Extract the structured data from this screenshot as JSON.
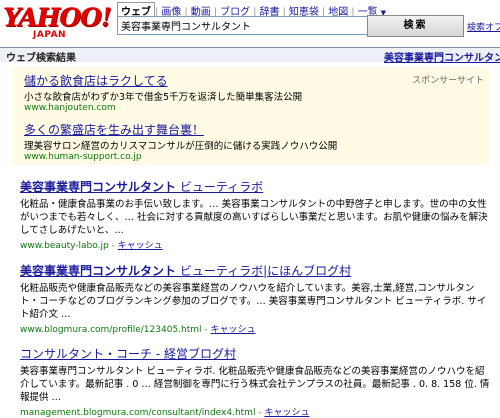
{
  "logo": {
    "main": "YAHOO!",
    "sub": "JAPAN"
  },
  "tabs": [
    "ウェブ",
    "画像",
    "動画",
    "ブログ",
    "辞書",
    "知恵袋",
    "地図",
    "一覧"
  ],
  "tabs_more_arrow": "▼",
  "search": {
    "value": "美容事業専門コンサルタント",
    "button_label": "検索",
    "option_label": "検索オプ"
  },
  "bar": {
    "left": "ウェブ検索結果",
    "right": "美容事業専門コンサルタン"
  },
  "ads": {
    "sponsor_label": "スポンサーサイト",
    "items": [
      {
        "title": "儲かる飲食店はラクしてる",
        "desc": "小さな飲食店がわずか3年で借金5千万を返済した簡単集客法公開",
        "url": "www.hanjouten.com"
      },
      {
        "title": "多くの繁盛店を生み出す舞台裏！",
        "desc": "理美容サロン経営のカリスマコンサルが圧倒的に儲ける実践ノウハウ公開",
        "url": "www.human-support.co.jp"
      }
    ]
  },
  "results": [
    {
      "title_bold": "美容事業専門コンサルタント",
      "title_rest": " ビューティラボ",
      "desc": "化粧品・健康食品事業のお手伝い致します。… 美容事業コンサルタントの中野啓子と申します。世の中の女性がいつまでも若々しく、… 社会に対する貢献度の高いすばらしい事業だと思います。お肌や健康の悩みを解決してさしあげたいと、…",
      "url": "www.beauty-labo.jp",
      "cache": "キャッシュ"
    },
    {
      "title_bold": "美容事業専門コンサルタント",
      "title_rest": " ビューティラボ|にほんブログ村",
      "desc": "化粧品販売や健康食品販売などの美容事業経営のノウハウを紹介しています。美容,士業,経営,コンサルタント・コーチなどのブログランキング参加のブログです。… 美容事業専門コンサルタント ビューティラボ. サイト紹介文 …",
      "url": "www.blogmura.com/profile/123405.html",
      "cache": "キャッシュ"
    },
    {
      "title_bold": "",
      "title_rest": "コンサルタント・コーチ - 経営ブログ村",
      "desc": "美容事業専門コンサルタント ビューティラボ. 化粧品販売や健康食品販売などの美容事業経営のノウハウを紹介しています。最新記事 . 0 … 経営制御を専門に行う株式会社テンプラスの社員。最新記事 . 0. 8. 158 位. 情報提供 …",
      "url": "management.blogmura.com/consultant/index4.html",
      "cache": "キャッシュ"
    }
  ],
  "url_separator": " - "
}
